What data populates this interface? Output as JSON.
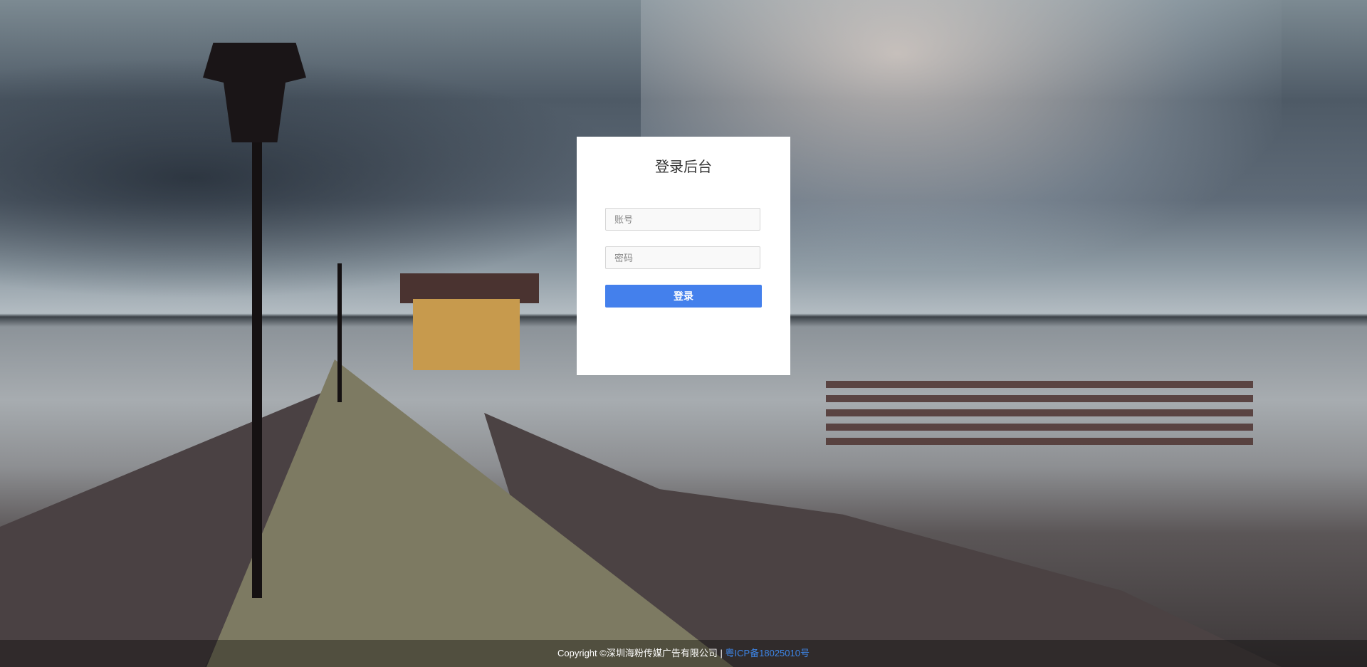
{
  "login": {
    "title": "登录后台",
    "account_placeholder": "账号",
    "password_placeholder": "密码",
    "submit_label": "登录",
    "accent_color": "#4480ec"
  },
  "footer": {
    "copyright": "Copyright ©深圳海粉传媒广告有限公司",
    "separator": "|",
    "icp_link": "粤ICP备18025010号"
  }
}
